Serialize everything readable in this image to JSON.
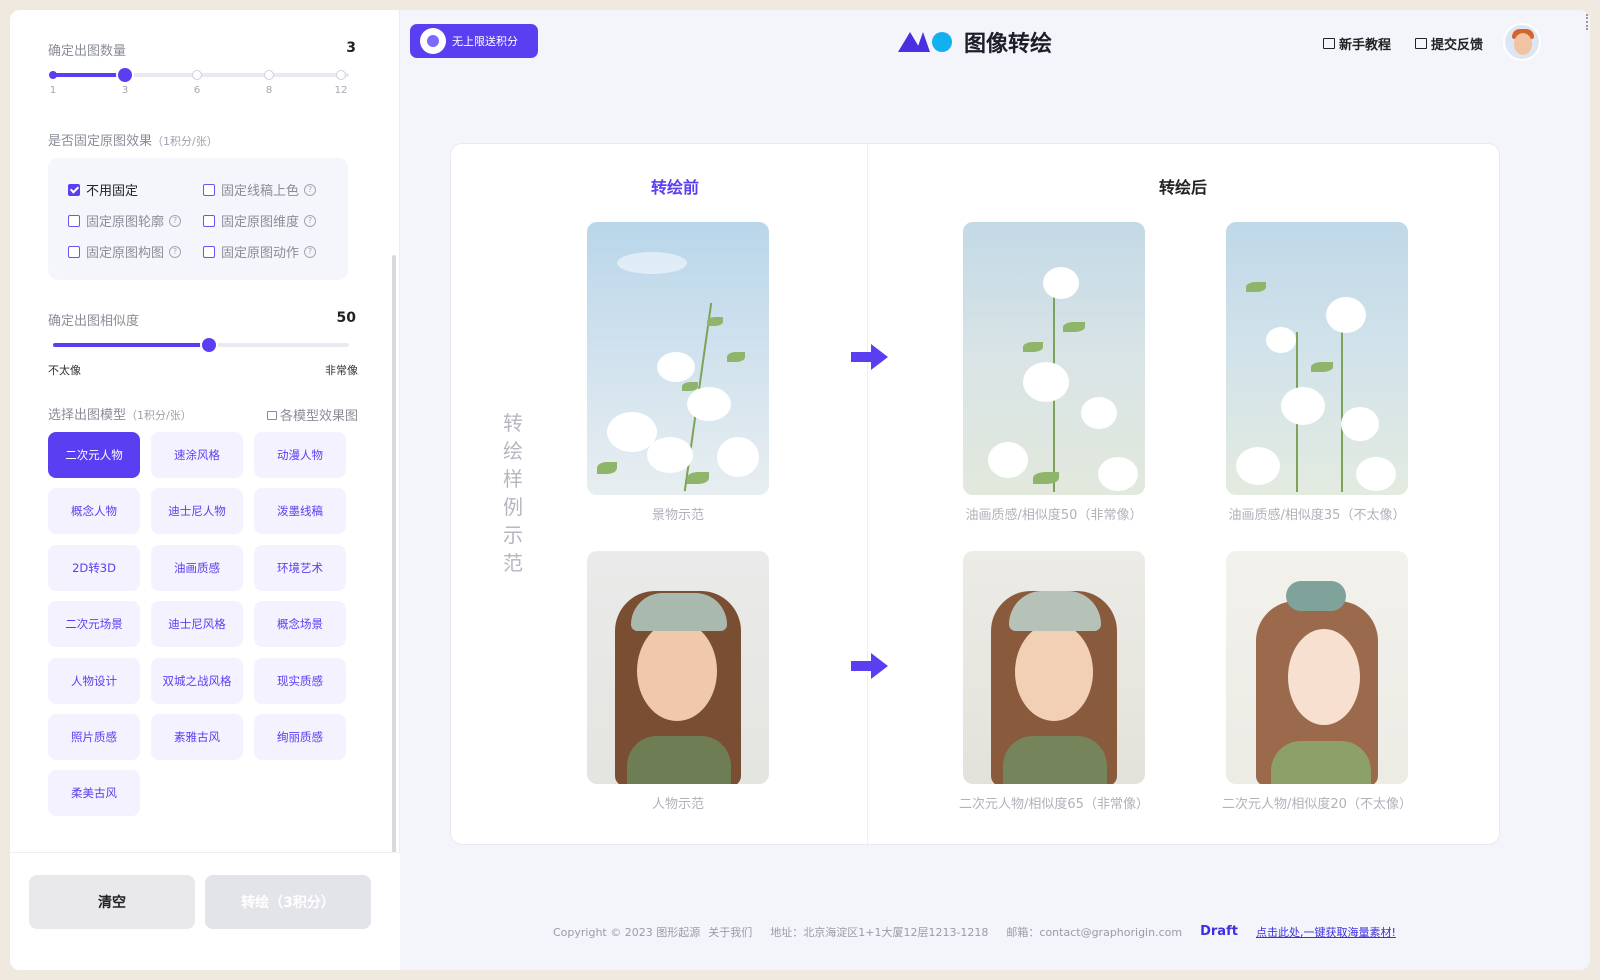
{
  "sidebar": {
    "count": {
      "label": "确定出图数量",
      "value": "3",
      "ticks": [
        "1",
        "3",
        "6",
        "8",
        "12"
      ],
      "selected_fraction": 0.25
    },
    "fix": {
      "label": "是否固定原图效果",
      "label_note": "（1积分/张）",
      "options": [
        {
          "label": "不用固定",
          "checked": true
        },
        {
          "label": "固定线稿上色",
          "checked": false
        },
        {
          "label": "固定原图轮廓",
          "checked": false
        },
        {
          "label": "固定原图维度",
          "checked": false
        },
        {
          "label": "固定原图构图",
          "checked": false
        },
        {
          "label": "固定原图动作",
          "checked": false
        }
      ],
      "help": "?"
    },
    "similarity": {
      "label": "确定出图相似度",
      "value": "50",
      "fraction": 0.54,
      "min_label": "不太像",
      "max_label": "非常像"
    },
    "models": {
      "label": "选择出图模型",
      "label_note": "（1积分/张）",
      "link": "各模型效果图",
      "items": [
        "二次元人物",
        "速涂风格",
        "动漫人物",
        "概念人物",
        "迪士尼人物",
        "泼墨线稿",
        "2D转3D",
        "油画质感",
        "环境艺术",
        "二次元场景",
        "迪士尼风格",
        "概念场景",
        "人物设计",
        "双城之战风格",
        "现实质感",
        "照片质感",
        "素雅古风",
        "绚丽质感",
        "柔美古风"
      ],
      "active_index": 0
    },
    "buttons": {
      "clear": "清空",
      "convert": "转绘（3积分）"
    }
  },
  "header": {
    "promo": "无上限送积分",
    "title": "图像转绘",
    "tutorial": "新手教程",
    "feedback": "提交反馈"
  },
  "demo": {
    "before_title": "转绘前",
    "after_title": "转绘后",
    "vertical_label": "转绘样例示范",
    "captions": {
      "scene_original": "景物示范",
      "scene_result_1": "油画质感/相似度50（非常像）",
      "scene_result_2": "油画质感/相似度35（不太像）",
      "person_original": "人物示范",
      "person_result_1": "二次元人物/相似度65（非常像）",
      "person_result_2": "二次元人物/相似度20（不太像）"
    },
    "accent_color": "#5a3ff2"
  },
  "footer": {
    "copyright": "Copyright © 2023 图形起源",
    "about": "关于我们",
    "address": "地址：北京海淀区1+1大厦12层1213-1218",
    "email": "邮箱：contact@graphorigin.com",
    "draft_logo": "Draft",
    "draft_link": "点击此处,一键获取海量素材!"
  }
}
